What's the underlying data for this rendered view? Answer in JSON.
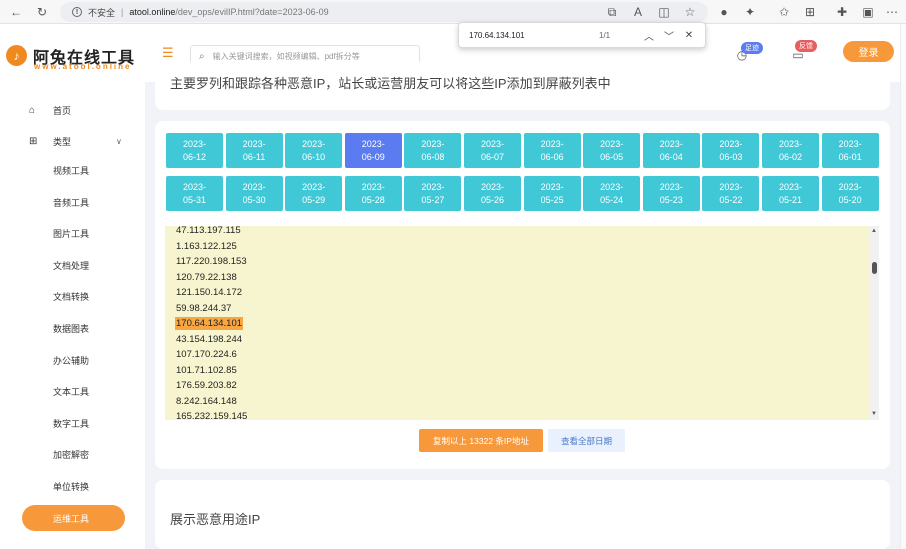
{
  "browser": {
    "insecure_label": "不安全",
    "url_host": "atool.online",
    "url_path": "/dev_ops/evilIP.html?date=2023-06-09",
    "find_query": "170.64.134.101",
    "find_count": "1/1"
  },
  "header": {
    "logo_title": "阿兔在线工具",
    "logo_sub": "www.atool.online",
    "search_placeholder": "输入关键词搜索，如视频编辑、pdf拆分等",
    "badge_tracking": "足迹",
    "badge_feedback": "反馈",
    "login_label": "登录"
  },
  "sidebar": {
    "home": "首页",
    "category": "类型",
    "items": [
      "视频工具",
      "音频工具",
      "图片工具",
      "文档处理",
      "文档转换",
      "数据图表",
      "办公辅助",
      "文本工具",
      "数字工具",
      "加密解密",
      "单位转换"
    ],
    "active": "运维工具"
  },
  "intro": {
    "text": "主要罗列和跟踪各种恶意IP，站长或运营朋友可以将这些IP添加到屏蔽列表中"
  },
  "dates": {
    "row1": [
      [
        "2023-",
        "06-12"
      ],
      [
        "2023-",
        "06-11"
      ],
      [
        "2023-",
        "06-10"
      ],
      [
        "2023-",
        "06-09"
      ],
      [
        "2023-",
        "06-08"
      ],
      [
        "2023-",
        "06-07"
      ],
      [
        "2023-",
        "06-06"
      ],
      [
        "2023-",
        "06-05"
      ],
      [
        "2023-",
        "06-04"
      ],
      [
        "2023-",
        "06-03"
      ],
      [
        "2023-",
        "06-02"
      ],
      [
        "2023-",
        "06-01"
      ]
    ],
    "row2": [
      [
        "2023-",
        "05-31"
      ],
      [
        "2023-",
        "05-30"
      ],
      [
        "2023-",
        "05-29"
      ],
      [
        "2023-",
        "05-28"
      ],
      [
        "2023-",
        "05-27"
      ],
      [
        "2023-",
        "05-26"
      ],
      [
        "2023-",
        "05-25"
      ],
      [
        "2023-",
        "05-24"
      ],
      [
        "2023-",
        "05-23"
      ],
      [
        "2023-",
        "05-22"
      ],
      [
        "2023-",
        "05-21"
      ],
      [
        "2023-",
        "05-20"
      ]
    ],
    "active": "2023-06-09"
  },
  "ip_list": [
    "47.113.197.115",
    "1.163.122.125",
    "117.220.198.153",
    "120.79.22.138",
    "121.150.14.172",
    "59.98.244.37",
    "170.64.134.101",
    "43.154.198.244",
    "107.170.224.6",
    "101.71.102.85",
    "176.59.203.82",
    "8.242.164.148",
    "165.232.159.145"
  ],
  "highlight_ip": "170.64.134.101",
  "actions": {
    "copy_label": "复制以上 13322 条IP地址",
    "view_all_label": "查看全部日期"
  },
  "section2": {
    "title": "展示恶意用途IP"
  }
}
